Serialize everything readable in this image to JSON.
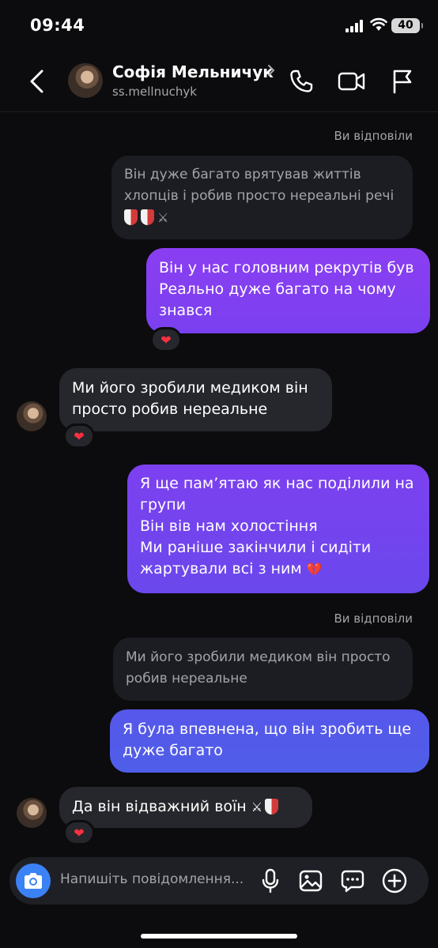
{
  "status_bar": {
    "time": "09:44",
    "battery": "40"
  },
  "header": {
    "name": "Софія Мельничук",
    "handle": "ss.mellnuchyk"
  },
  "messages": {
    "reply_label_1": "Ви відповіли",
    "quote_1": [
      "Він дуже багато врятував життів",
      "хлопців і робив просто нереальні речі"
    ],
    "out_1": [
      "Він у нас головним рекрутів був",
      "Реально дуже багато на чому",
      "знався"
    ],
    "in_1": [
      "Ми його зробили медиком він",
      "просто робив нереальне"
    ],
    "out_2": [
      "Я ще пам’ятаю як нас поділили на",
      "групи",
      "Він вів нам холостіння",
      "Ми раніше закінчили і сидіти",
      "жартували всі з ним"
    ],
    "reply_label_2": "Ви відповіли",
    "quote_2": [
      "Ми його зробили медиком він просто",
      "робив нереальне"
    ],
    "out_3": [
      "Я була впевнена, що він зробить ще",
      "дуже багато"
    ],
    "in_2": "Да він відважний воїн",
    "reaction": "❤"
  },
  "emojis": {
    "swords": "⚔",
    "broken_heart": "💔"
  },
  "composer": {
    "placeholder": "Напишіть повідомлення..."
  },
  "colors": {
    "outgoing_top": "#8b3ef2",
    "outgoing_bottom": "#4f5ee8",
    "incoming": "#26272c",
    "accent": "#3b82f6"
  }
}
